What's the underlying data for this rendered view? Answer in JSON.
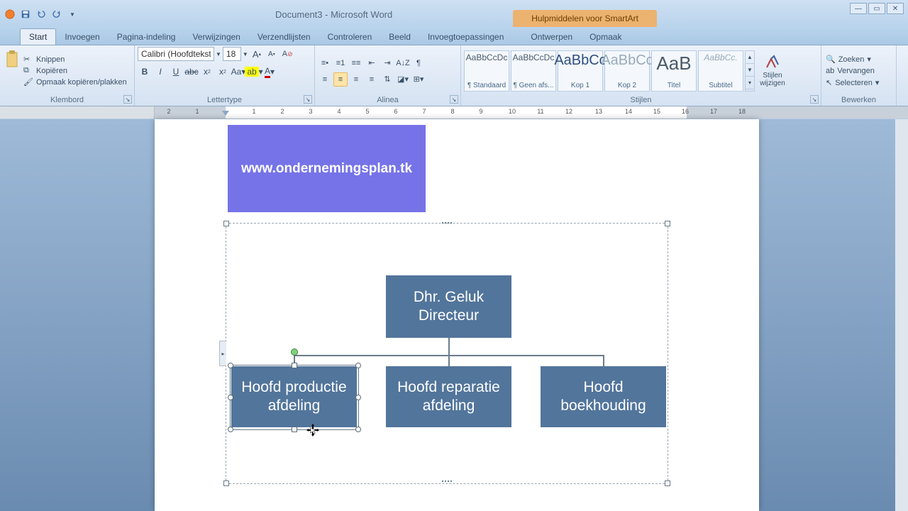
{
  "title": "Document3 - Microsoft Word",
  "smartart_tools_label": "Hulpmiddelen voor SmartArt",
  "tabs": {
    "start": "Start",
    "invoegen": "Invoegen",
    "pagina": "Pagina-indeling",
    "verwijzingen": "Verwijzingen",
    "verzendlijsten": "Verzendlijsten",
    "controleren": "Controleren",
    "beeld": "Beeld",
    "invoegtoep": "Invoegtoepassingen",
    "ontwerpen": "Ontwerpen",
    "opmaak": "Opmaak"
  },
  "clipboard": {
    "knippen": "Knippen",
    "kopieren": "Kopiëren",
    "opmaak": "Opmaak kopiëren/plakken",
    "group": "Klembord"
  },
  "font": {
    "name": "Calibri (Hoofdtekst)",
    "size": "18",
    "group": "Lettertype"
  },
  "para": {
    "group": "Alinea"
  },
  "styles": {
    "items": [
      {
        "preview": "AaBbCcDc",
        "label": "¶ Standaard"
      },
      {
        "preview": "AaBbCcDc",
        "label": "¶ Geen afs..."
      },
      {
        "preview": "AaBbCc",
        "label": "Kop 1"
      },
      {
        "preview": "AaBbCc",
        "label": "Kop 2"
      },
      {
        "preview": "AaB",
        "label": "Titel"
      },
      {
        "preview": "AaBbCc.",
        "label": "Subtitel"
      }
    ],
    "change": "Stijlen wijzigen",
    "group": "Stijlen"
  },
  "editing": {
    "zoeken": "Zoeken",
    "vervangen": "Vervangen",
    "selecteren": "Selecteren",
    "group": "Bewerken"
  },
  "banner_text": "www.ondernemingsplan.tk",
  "org": {
    "top": "Dhr. Geluk\nDirecteur",
    "b1": "Hoofd productie afdeling",
    "b2": "Hoofd reparatie afdeling",
    "b3": "Hoofd boekhouding"
  },
  "ruler_numbers": [
    "2",
    "1",
    "1",
    "2",
    "3",
    "4",
    "5",
    "6",
    "7",
    "8",
    "9",
    "10",
    "11",
    "12",
    "13",
    "14",
    "15",
    "16",
    "17",
    "18"
  ]
}
